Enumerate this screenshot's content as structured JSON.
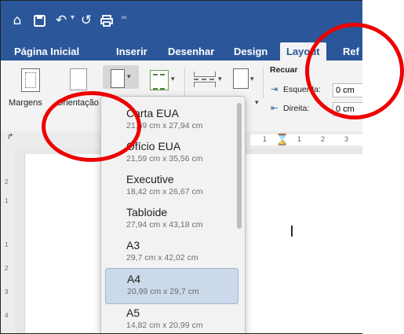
{
  "titlebar": {
    "icons": [
      "home-icon",
      "save-icon",
      "undo-icon",
      "redo-icon",
      "print-icon",
      "customize-icon"
    ]
  },
  "tabs": [
    {
      "label": "Página Inicial"
    },
    {
      "label": "Inserir"
    },
    {
      "label": "Desenhar"
    },
    {
      "label": "Design"
    },
    {
      "label": "Layout",
      "active": true
    },
    {
      "label": "Ref"
    }
  ],
  "ribbon": {
    "margins_label": "Margens",
    "orientation_label": "Orientação",
    "indent_title": "Recuar",
    "left_label": "Esquerda:",
    "left_value": "0 cm",
    "right_label": "Direita:",
    "right_value": "0 cm"
  },
  "page_sizes": [
    {
      "name": "Carta EUA",
      "size": "21,59 cm x 27,94 cm",
      "selected": false
    },
    {
      "name": "Ofício EUA",
      "size": "21,59 cm x 35,56 cm",
      "selected": false
    },
    {
      "name": "Executive",
      "size": "18,42 cm x 26,67 cm",
      "selected": false
    },
    {
      "name": "Tabloide",
      "size": "27,94 cm x 43,18 cm",
      "selected": false
    },
    {
      "name": "A3",
      "size": "29,7 cm x 42,02 cm",
      "selected": false
    },
    {
      "name": "A4",
      "size": "20,99 cm x 29,7 cm",
      "selected": true
    },
    {
      "name": "A5",
      "size": "14,82 cm x 20,99 cm",
      "selected": false
    }
  ],
  "ruler": {
    "labels": [
      "1",
      "1",
      "2",
      "3"
    ]
  },
  "vruler": {
    "labels": [
      "2",
      "1",
      "1",
      "2",
      "3",
      "4"
    ]
  },
  "colors": {
    "accent": "#2b579a",
    "selected": "#ccd9ea",
    "annotation": "#ee0000"
  }
}
